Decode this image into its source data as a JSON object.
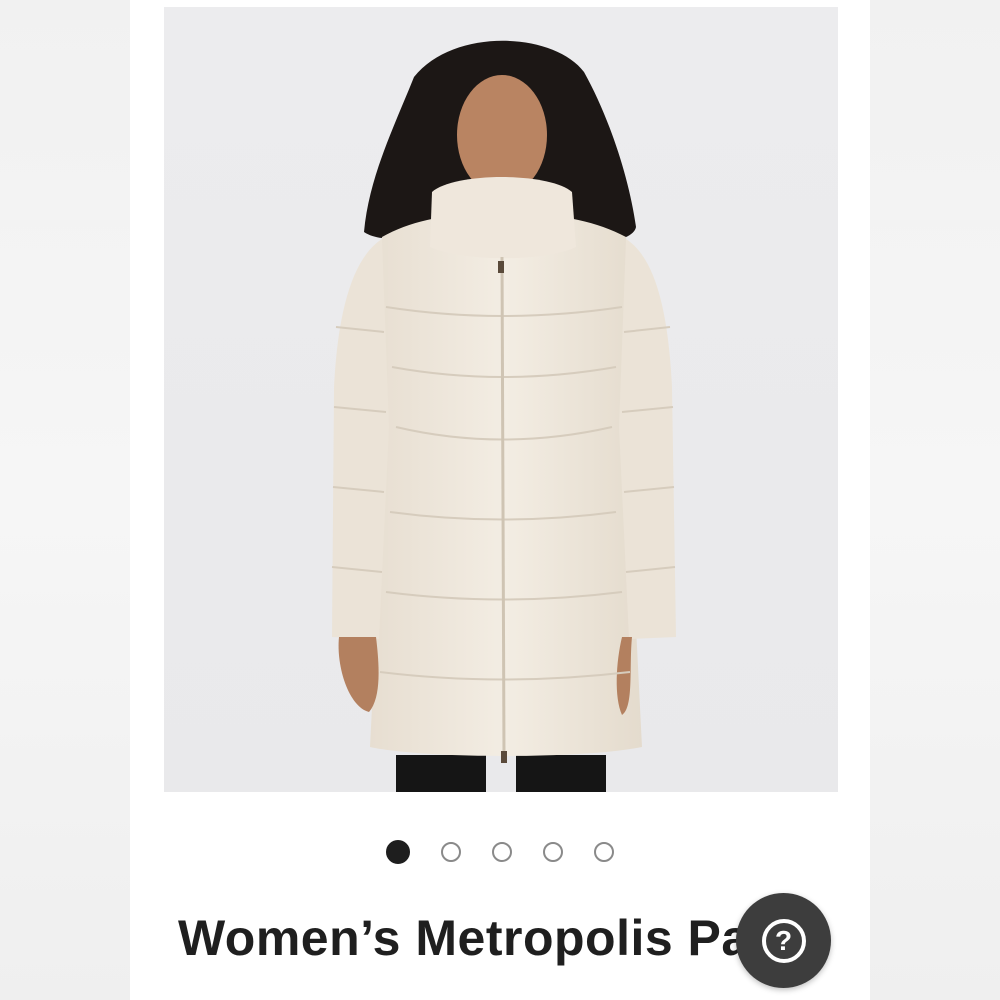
{
  "product": {
    "title": "Women’s Metropolis Parka",
    "image_alt": "Woman wearing a long cream-colored quilted down parka with high collar and black leggings",
    "coat_color": "#eee6da"
  },
  "carousel": {
    "total": 5,
    "active_index": 0
  },
  "help": {
    "icon": "question-mark-icon",
    "glyph": "?"
  }
}
